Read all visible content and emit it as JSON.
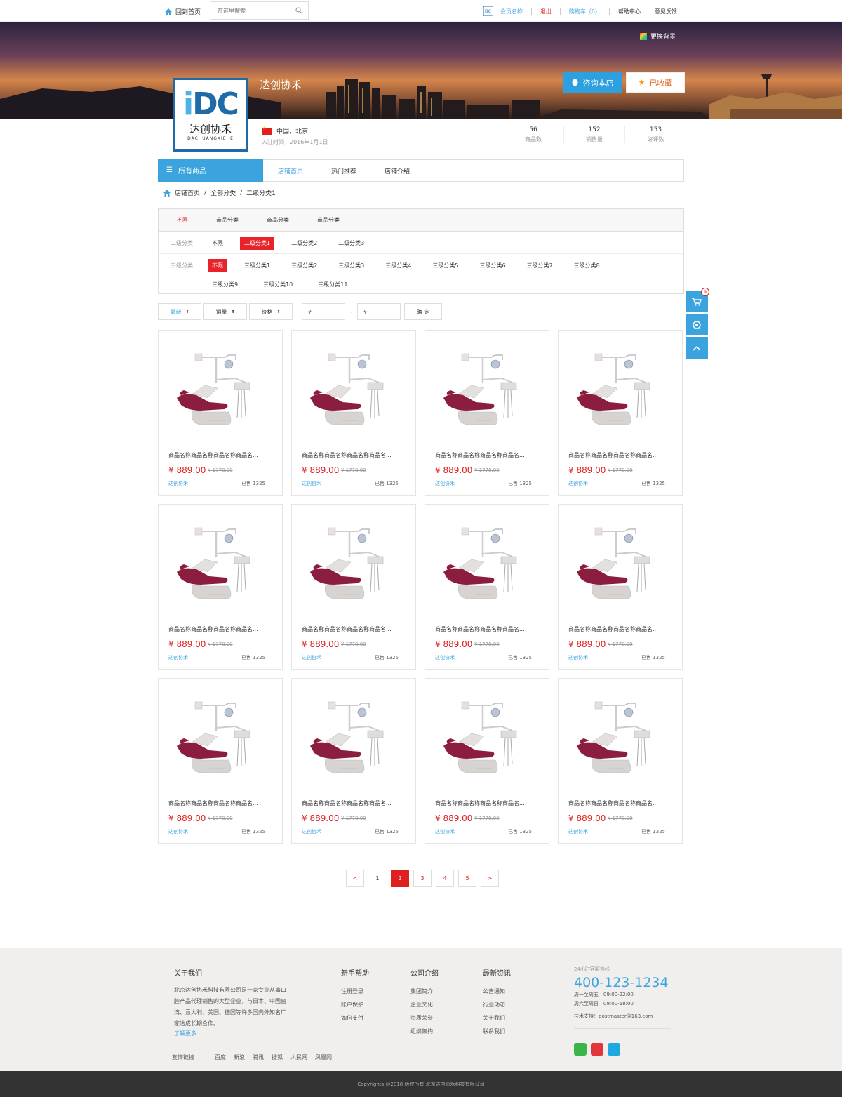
{
  "topbar": {
    "home": "回到首页",
    "search_placeholder": "在这里搜索",
    "member": "会员名称",
    "logout": "退出",
    "cart": "购物车（0）",
    "help": "帮助中心",
    "feedback": "意见反馈"
  },
  "banner": {
    "change_bg": "更换背景",
    "consult": "咨询本店",
    "favorited": "已收藏"
  },
  "shop": {
    "name": "达创协禾",
    "logo_en": "DACHUANGXIEHE",
    "location": "中国，北京",
    "joined": "入驻时间　2016年1月1日",
    "stats": [
      {
        "num": "56",
        "label": "商品数"
      },
      {
        "num": "152",
        "label": "销售量"
      },
      {
        "num": "153",
        "label": "好评数"
      }
    ]
  },
  "nav": {
    "all": "所有商品",
    "items": [
      "店铺首页",
      "热门推荐",
      "店铺介绍"
    ]
  },
  "breadcrumb": [
    "店铺首页",
    "/",
    "全部分类",
    "/",
    "二级分类1"
  ],
  "filter": {
    "tabs": [
      "不限",
      "商品分类",
      "商品分类",
      "商品分类"
    ],
    "level2_label": "二级分类",
    "level2": [
      "不限",
      "二级分类1",
      "二级分类2",
      "二级分类3"
    ],
    "level2_selected": 1,
    "level3_label": "三级分类",
    "level3_row1": [
      "不限",
      "三级分类1",
      "三级分类2",
      "三级分类3",
      "三级分类4",
      "三级分类5",
      "三级分类6",
      "三级分类7",
      "三级分类8"
    ],
    "level3_row2": [
      "三级分类9",
      "三级分类10",
      "三级分类11"
    ]
  },
  "sort": {
    "newest": "最新",
    "sales": "销量",
    "price": "价格",
    "price_from": "¥",
    "dash": "-",
    "price_to": "¥",
    "confirm": "确 定"
  },
  "product": {
    "name": "商品名称商品名称商品名称商品名...",
    "price": "¥ 889.00",
    "orig_price": "¥ 1778.00",
    "shop": "达创协禾",
    "sold": "已售 1325"
  },
  "pager": {
    "prev": "<",
    "pages": [
      "1",
      "2",
      "3",
      "4",
      "5"
    ],
    "current": "2",
    "next": ">"
  },
  "side": {
    "cart_count": "9"
  },
  "footer": {
    "about_title": "关于我们",
    "about_text": "北京达创协禾科技有限公司是一家专业从事口腔产品代理销售的大型企业，与日本、中国台湾、意大利、美国、德国等许多国内外知名厂家达成长期合作。",
    "about_more": "了解更多",
    "cols": [
      {
        "title": "新手帮助",
        "items": [
          "注册登录",
          "账户保护",
          "如何支付"
        ]
      },
      {
        "title": "公司介绍",
        "items": [
          "集团简介",
          "企业文化",
          "资质荣誉",
          "组织架构"
        ]
      },
      {
        "title": "最新资讯",
        "items": [
          "公告通知",
          "行业动态",
          "关于我们",
          "联系我们"
        ]
      }
    ],
    "hotline_title": "24小时客服热线",
    "hotline": "400-123-1234",
    "hours1": "周一至周五　09:00-22:00",
    "hours2": "周六至周日　09:00-18:00",
    "support": "技术支持：postmaster@163.com",
    "links_label": "友情链接",
    "links": [
      "百度",
      "新浪",
      "腾讯",
      "搜狐",
      "人民网",
      "凤凰网"
    ],
    "copyright": "Copyrights @2018  版权所有 北京达创协禾科技有限公司"
  }
}
